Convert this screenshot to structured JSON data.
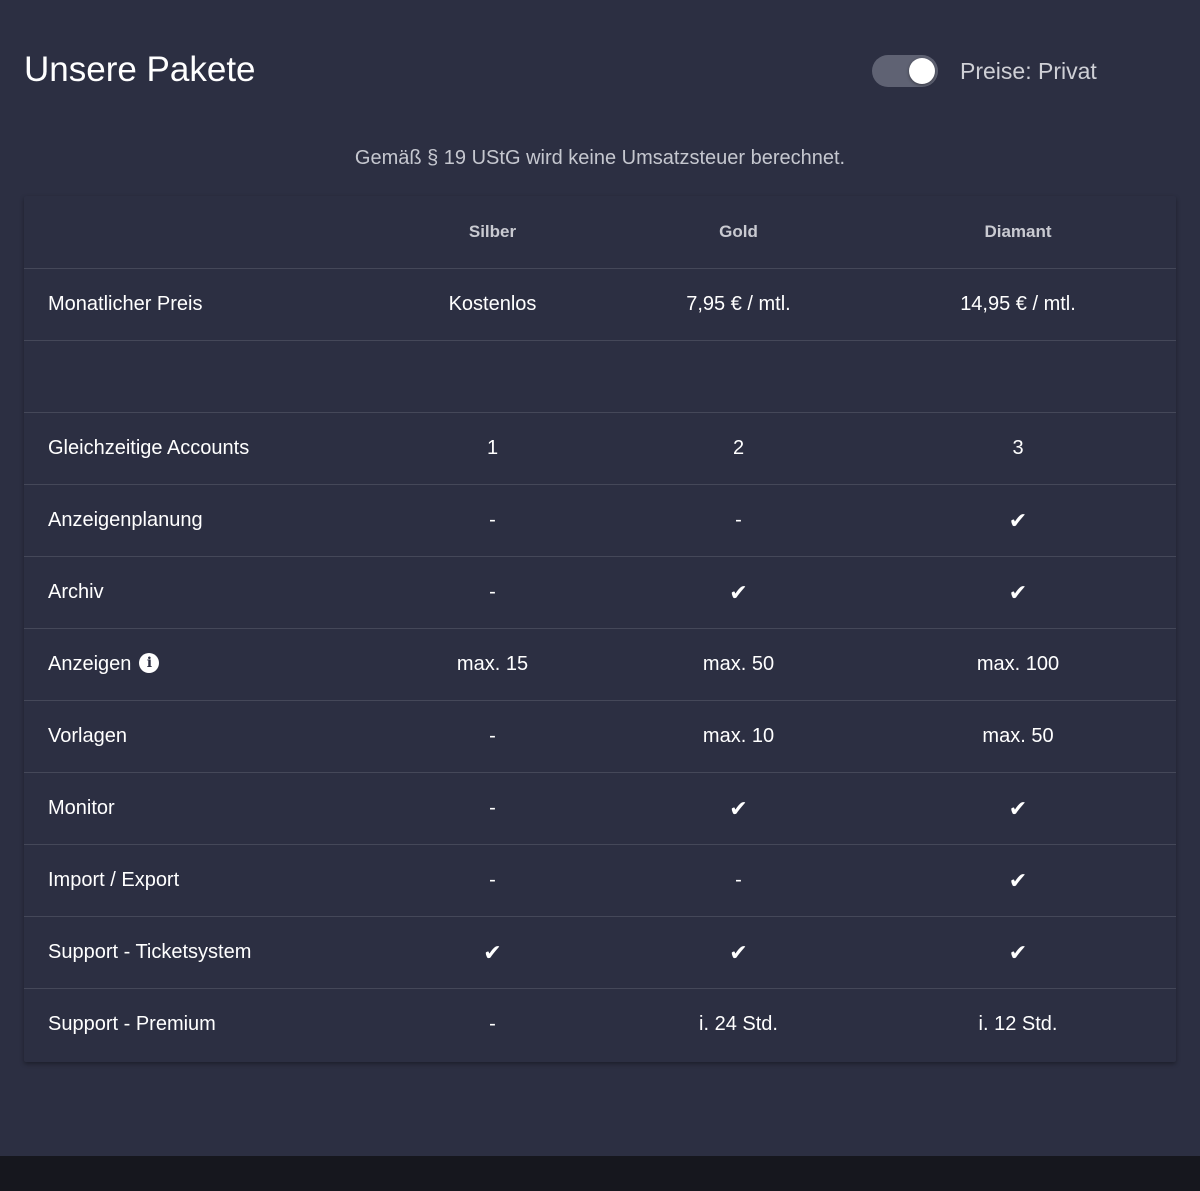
{
  "header": {
    "title": "Unsere Pakete",
    "toggle_label": "Preise: Privat",
    "toggle_on": true
  },
  "tax_note": "Gemäß § 19 UStG wird keine Umsatzsteuer berechnet.",
  "table": {
    "columns": [
      "",
      "Silber",
      "Gold",
      "Diamant"
    ],
    "rows": [
      {
        "label": "Monatlicher Preis",
        "values": [
          "Kostenlos",
          "7,95 € / mtl.",
          "14,95 € / mtl."
        ]
      },
      {
        "label": "",
        "values": [
          "",
          "",
          ""
        ]
      },
      {
        "label": "Gleichzeitige Accounts",
        "values": [
          "1",
          "2",
          "3"
        ]
      },
      {
        "label": "Anzeigenplanung",
        "values": [
          "-",
          "-",
          "✔"
        ]
      },
      {
        "label": "Archiv",
        "values": [
          "-",
          "✔",
          "✔"
        ]
      },
      {
        "label": "Anzeigen",
        "info_icon": "info-icon",
        "values": [
          "max. 15",
          "max. 50",
          "max. 100"
        ]
      },
      {
        "label": "Vorlagen",
        "values": [
          "-",
          "max. 10",
          "max. 50"
        ]
      },
      {
        "label": "Monitor",
        "values": [
          "-",
          "✔",
          "✔"
        ]
      },
      {
        "label": "Import / Export",
        "values": [
          "-",
          "-",
          "✔"
        ]
      },
      {
        "label": "Support - Ticketsystem",
        "values": [
          "✔",
          "✔",
          "✔"
        ]
      },
      {
        "label": "Support - Premium",
        "values": [
          "-",
          "i. 24 Std.",
          "i. 12 Std."
        ]
      }
    ]
  },
  "colors": {
    "background": "#2c2f42",
    "footer": "#16171e",
    "divider": "#454859",
    "text": "#ffffff",
    "muted_text": "#c5c7cf"
  }
}
